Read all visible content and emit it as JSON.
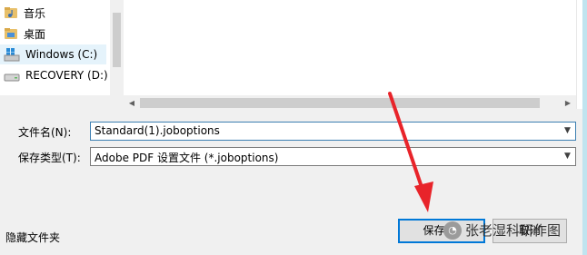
{
  "nav": {
    "items": [
      {
        "label": "音乐",
        "icon": "music-folder-icon"
      },
      {
        "label": "桌面",
        "icon": "desktop-folder-icon"
      },
      {
        "label": "Windows (C:)",
        "icon": "windows-drive-icon",
        "selected": true
      },
      {
        "label": "RECOVERY (D:)",
        "icon": "drive-icon"
      }
    ]
  },
  "form": {
    "filename_label": "文件名(N):",
    "filename_value": "Standard(1).joboptions",
    "savetype_label": "保存类型(T):",
    "savetype_value": "Adobe PDF 设置文件 (*.joboptions)"
  },
  "footer": {
    "hide_folders_label": "隐藏文件夹",
    "save_label": "保存(S)",
    "cancel_label": "取消",
    "watermark_text": "张老湿科研作图"
  },
  "colors": {
    "annotation_arrow": "#e8242a",
    "selection": "#e5f3fb",
    "focus_border": "#0078d7"
  }
}
